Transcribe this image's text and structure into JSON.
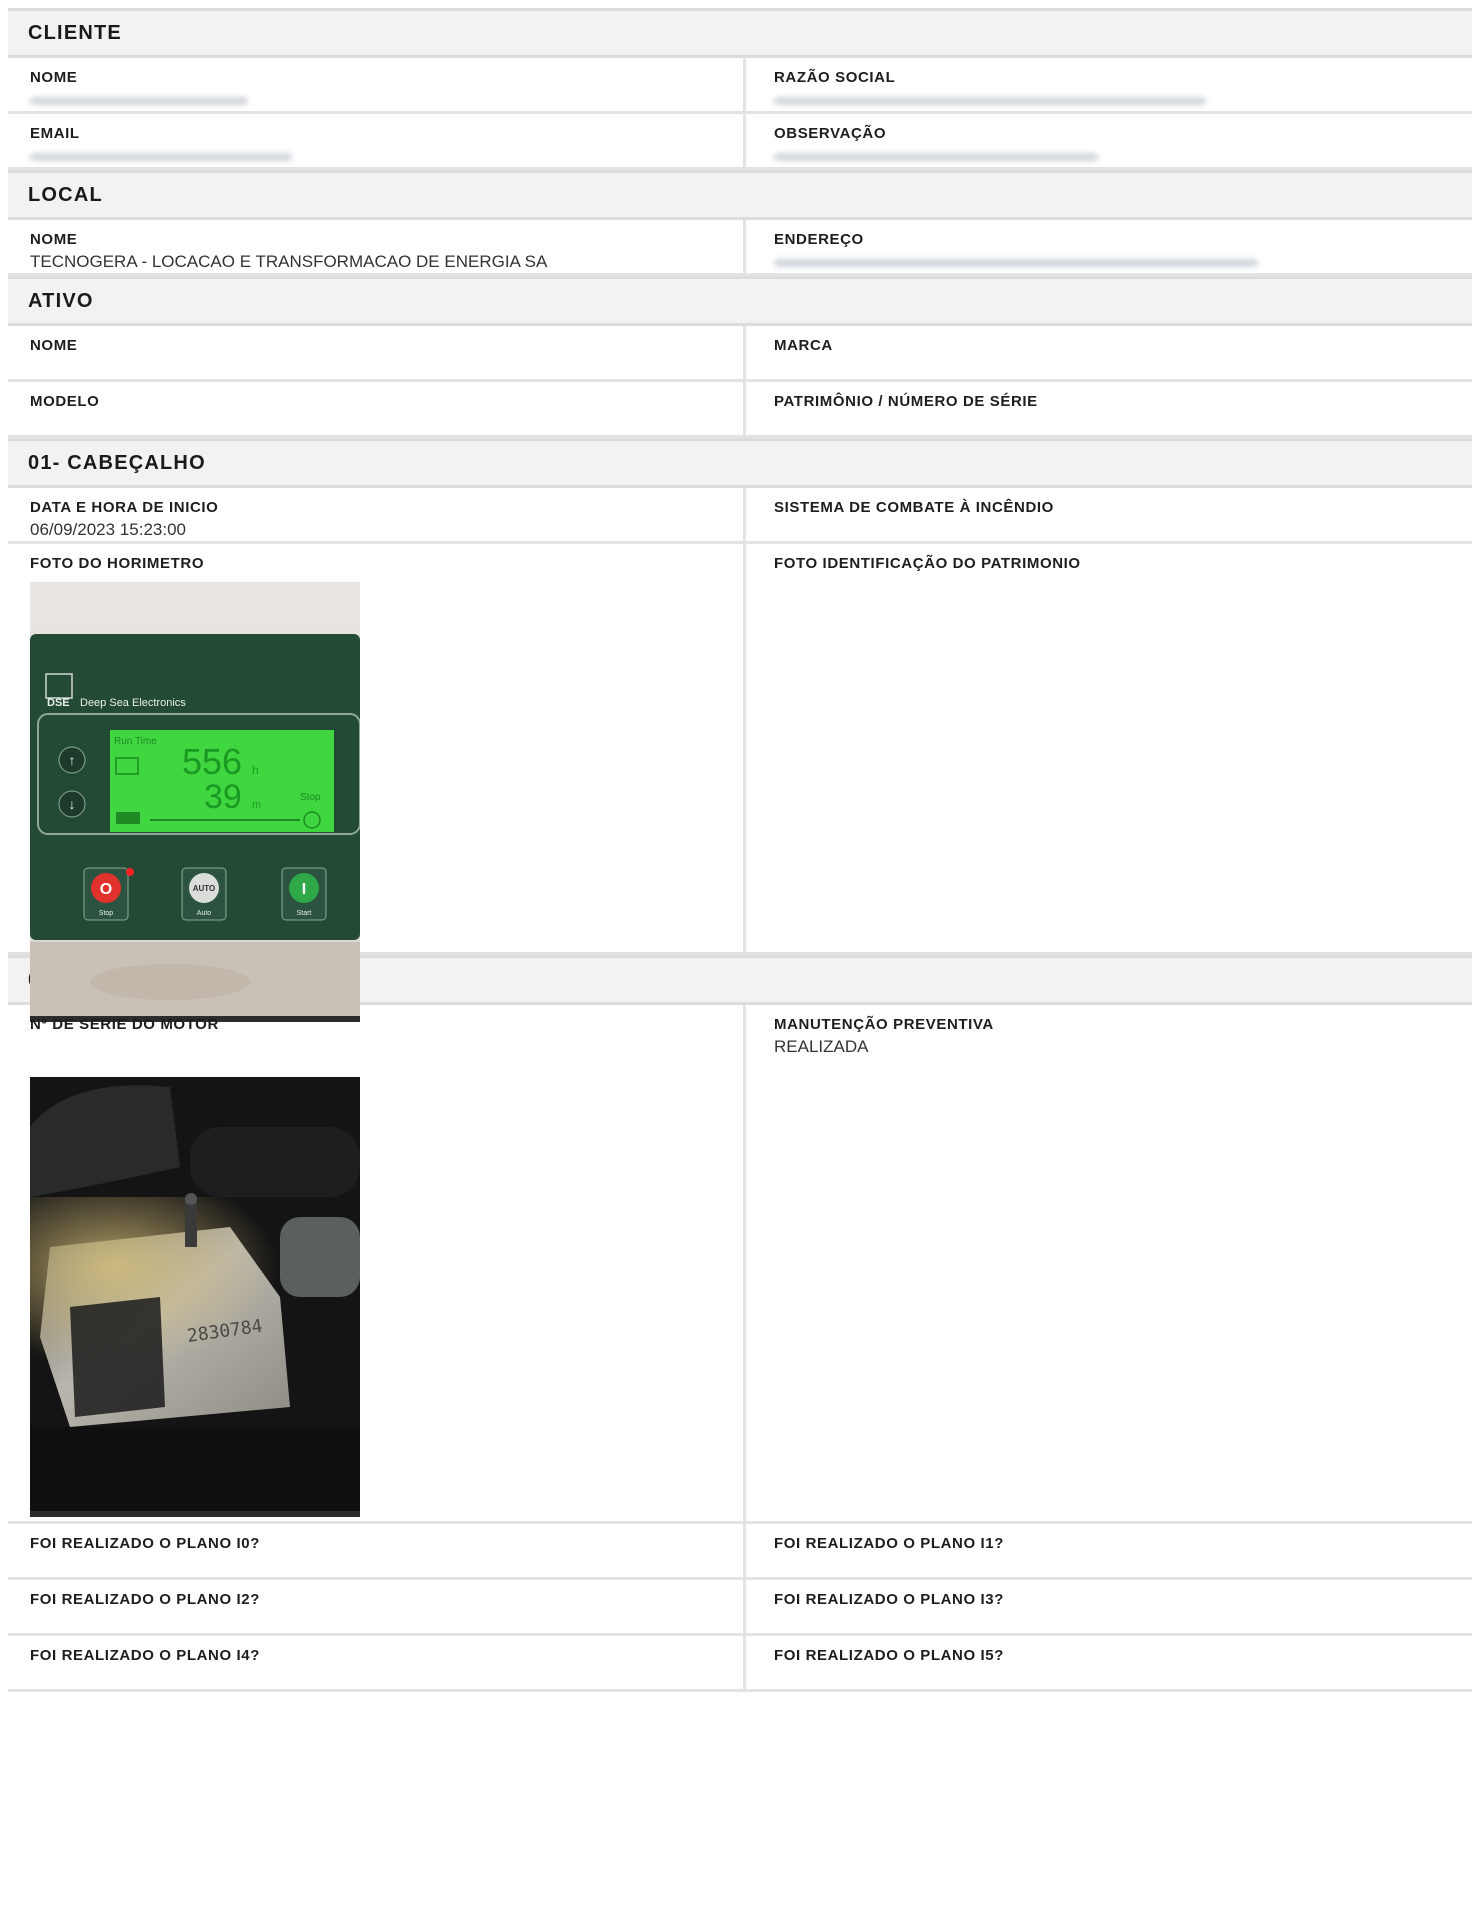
{
  "sections": {
    "cliente": {
      "title": "CLIENTE",
      "nome_label": "NOME",
      "razao_label": "RAZÃO SOCIAL",
      "email_label": "EMAIL",
      "obs_label": "OBSERVAÇÃO"
    },
    "local": {
      "title": "LOCAL",
      "nome_label": "NOME",
      "nome_value": "TECNOGERA - LOCACAO E TRANSFORMACAO DE ENERGIA SA",
      "endereco_label": "ENDEREÇO"
    },
    "ativo": {
      "title": "ATIVO",
      "nome_label": "NOME",
      "marca_label": "MARCA",
      "modelo_label": "MODELO",
      "patrimonio_label": "PATRIMÔNIO / NÚMERO DE SÉRIE"
    },
    "cabecalho": {
      "title": "01- CABEÇALHO",
      "data_label": "DATA E HORA DE INICIO",
      "data_value": "06/09/2023 15:23:00",
      "sistema_label": "SISTEMA DE COMBATE À INCÊNDIO",
      "horimetro_label": "FOTO DO HORIMETRO",
      "patrimonio_foto_label": "FOTO IDENTIFICAÇÃO DO PATRIMONIO",
      "horimetro_photo": {
        "brand": "DSE",
        "brand_text": "Deep Sea Electronics",
        "run_time": "Run\nTime",
        "hours": "556",
        "hours_unit": "h",
        "minutes": "39",
        "minutes_unit": "m",
        "stop_tag": "Stop",
        "btn_stop_glyph": "O",
        "btn_stop": "Stop",
        "btn_auto_glyph": "AUTO",
        "btn_auto": "Auto",
        "btn_start_glyph": "I",
        "btn_start": "Start"
      }
    },
    "motor": {
      "title": "02- MOTOR",
      "serie_label": "Nº DE SERIE DO MOTOR",
      "manut_label": "MANUTENÇÃO PREVENTIVA",
      "manut_value": "REALIZADA",
      "serial_photo_text": "2830784",
      "plans": [
        "FOI REALIZADO O PLANO I0?",
        "FOI REALIZADO O PLANO I1?",
        "FOI REALIZADO O PLANO I2?",
        "FOI REALIZADO O PLANO I3?",
        "FOI REALIZADO O PLANO I4?",
        "FOI REALIZADO O PLANO I5?"
      ]
    }
  },
  "colors": {
    "section_bg": "#f2f2f2",
    "border": "#e3e3e3",
    "display_green": "#3fd640",
    "panel_green": "#234a35"
  }
}
